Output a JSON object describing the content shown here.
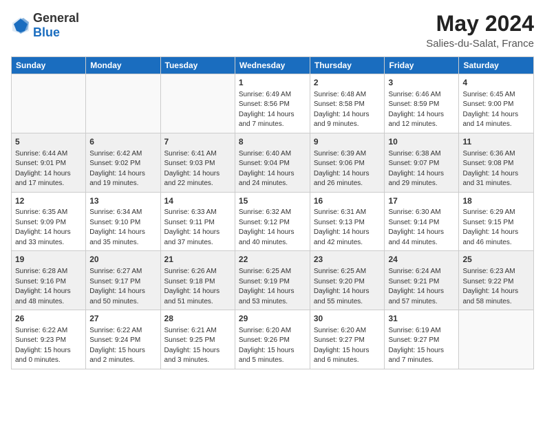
{
  "header": {
    "logo_general": "General",
    "logo_blue": "Blue",
    "month_year": "May 2024",
    "location": "Salies-du-Salat, France"
  },
  "days_of_week": [
    "Sunday",
    "Monday",
    "Tuesday",
    "Wednesday",
    "Thursday",
    "Friday",
    "Saturday"
  ],
  "weeks": [
    {
      "shaded": false,
      "days": [
        {
          "num": "",
          "detail": ""
        },
        {
          "num": "",
          "detail": ""
        },
        {
          "num": "",
          "detail": ""
        },
        {
          "num": "1",
          "detail": "Sunrise: 6:49 AM\nSunset: 8:56 PM\nDaylight: 14 hours\nand 7 minutes."
        },
        {
          "num": "2",
          "detail": "Sunrise: 6:48 AM\nSunset: 8:58 PM\nDaylight: 14 hours\nand 9 minutes."
        },
        {
          "num": "3",
          "detail": "Sunrise: 6:46 AM\nSunset: 8:59 PM\nDaylight: 14 hours\nand 12 minutes."
        },
        {
          "num": "4",
          "detail": "Sunrise: 6:45 AM\nSunset: 9:00 PM\nDaylight: 14 hours\nand 14 minutes."
        }
      ]
    },
    {
      "shaded": true,
      "days": [
        {
          "num": "5",
          "detail": "Sunrise: 6:44 AM\nSunset: 9:01 PM\nDaylight: 14 hours\nand 17 minutes."
        },
        {
          "num": "6",
          "detail": "Sunrise: 6:42 AM\nSunset: 9:02 PM\nDaylight: 14 hours\nand 19 minutes."
        },
        {
          "num": "7",
          "detail": "Sunrise: 6:41 AM\nSunset: 9:03 PM\nDaylight: 14 hours\nand 22 minutes."
        },
        {
          "num": "8",
          "detail": "Sunrise: 6:40 AM\nSunset: 9:04 PM\nDaylight: 14 hours\nand 24 minutes."
        },
        {
          "num": "9",
          "detail": "Sunrise: 6:39 AM\nSunset: 9:06 PM\nDaylight: 14 hours\nand 26 minutes."
        },
        {
          "num": "10",
          "detail": "Sunrise: 6:38 AM\nSunset: 9:07 PM\nDaylight: 14 hours\nand 29 minutes."
        },
        {
          "num": "11",
          "detail": "Sunrise: 6:36 AM\nSunset: 9:08 PM\nDaylight: 14 hours\nand 31 minutes."
        }
      ]
    },
    {
      "shaded": false,
      "days": [
        {
          "num": "12",
          "detail": "Sunrise: 6:35 AM\nSunset: 9:09 PM\nDaylight: 14 hours\nand 33 minutes."
        },
        {
          "num": "13",
          "detail": "Sunrise: 6:34 AM\nSunset: 9:10 PM\nDaylight: 14 hours\nand 35 minutes."
        },
        {
          "num": "14",
          "detail": "Sunrise: 6:33 AM\nSunset: 9:11 PM\nDaylight: 14 hours\nand 37 minutes."
        },
        {
          "num": "15",
          "detail": "Sunrise: 6:32 AM\nSunset: 9:12 PM\nDaylight: 14 hours\nand 40 minutes."
        },
        {
          "num": "16",
          "detail": "Sunrise: 6:31 AM\nSunset: 9:13 PM\nDaylight: 14 hours\nand 42 minutes."
        },
        {
          "num": "17",
          "detail": "Sunrise: 6:30 AM\nSunset: 9:14 PM\nDaylight: 14 hours\nand 44 minutes."
        },
        {
          "num": "18",
          "detail": "Sunrise: 6:29 AM\nSunset: 9:15 PM\nDaylight: 14 hours\nand 46 minutes."
        }
      ]
    },
    {
      "shaded": true,
      "days": [
        {
          "num": "19",
          "detail": "Sunrise: 6:28 AM\nSunset: 9:16 PM\nDaylight: 14 hours\nand 48 minutes."
        },
        {
          "num": "20",
          "detail": "Sunrise: 6:27 AM\nSunset: 9:17 PM\nDaylight: 14 hours\nand 50 minutes."
        },
        {
          "num": "21",
          "detail": "Sunrise: 6:26 AM\nSunset: 9:18 PM\nDaylight: 14 hours\nand 51 minutes."
        },
        {
          "num": "22",
          "detail": "Sunrise: 6:25 AM\nSunset: 9:19 PM\nDaylight: 14 hours\nand 53 minutes."
        },
        {
          "num": "23",
          "detail": "Sunrise: 6:25 AM\nSunset: 9:20 PM\nDaylight: 14 hours\nand 55 minutes."
        },
        {
          "num": "24",
          "detail": "Sunrise: 6:24 AM\nSunset: 9:21 PM\nDaylight: 14 hours\nand 57 minutes."
        },
        {
          "num": "25",
          "detail": "Sunrise: 6:23 AM\nSunset: 9:22 PM\nDaylight: 14 hours\nand 58 minutes."
        }
      ]
    },
    {
      "shaded": false,
      "days": [
        {
          "num": "26",
          "detail": "Sunrise: 6:22 AM\nSunset: 9:23 PM\nDaylight: 15 hours\nand 0 minutes."
        },
        {
          "num": "27",
          "detail": "Sunrise: 6:22 AM\nSunset: 9:24 PM\nDaylight: 15 hours\nand 2 minutes."
        },
        {
          "num": "28",
          "detail": "Sunrise: 6:21 AM\nSunset: 9:25 PM\nDaylight: 15 hours\nand 3 minutes."
        },
        {
          "num": "29",
          "detail": "Sunrise: 6:20 AM\nSunset: 9:26 PM\nDaylight: 15 hours\nand 5 minutes."
        },
        {
          "num": "30",
          "detail": "Sunrise: 6:20 AM\nSunset: 9:27 PM\nDaylight: 15 hours\nand 6 minutes."
        },
        {
          "num": "31",
          "detail": "Sunrise: 6:19 AM\nSunset: 9:27 PM\nDaylight: 15 hours\nand 7 minutes."
        },
        {
          "num": "",
          "detail": ""
        }
      ]
    }
  ]
}
